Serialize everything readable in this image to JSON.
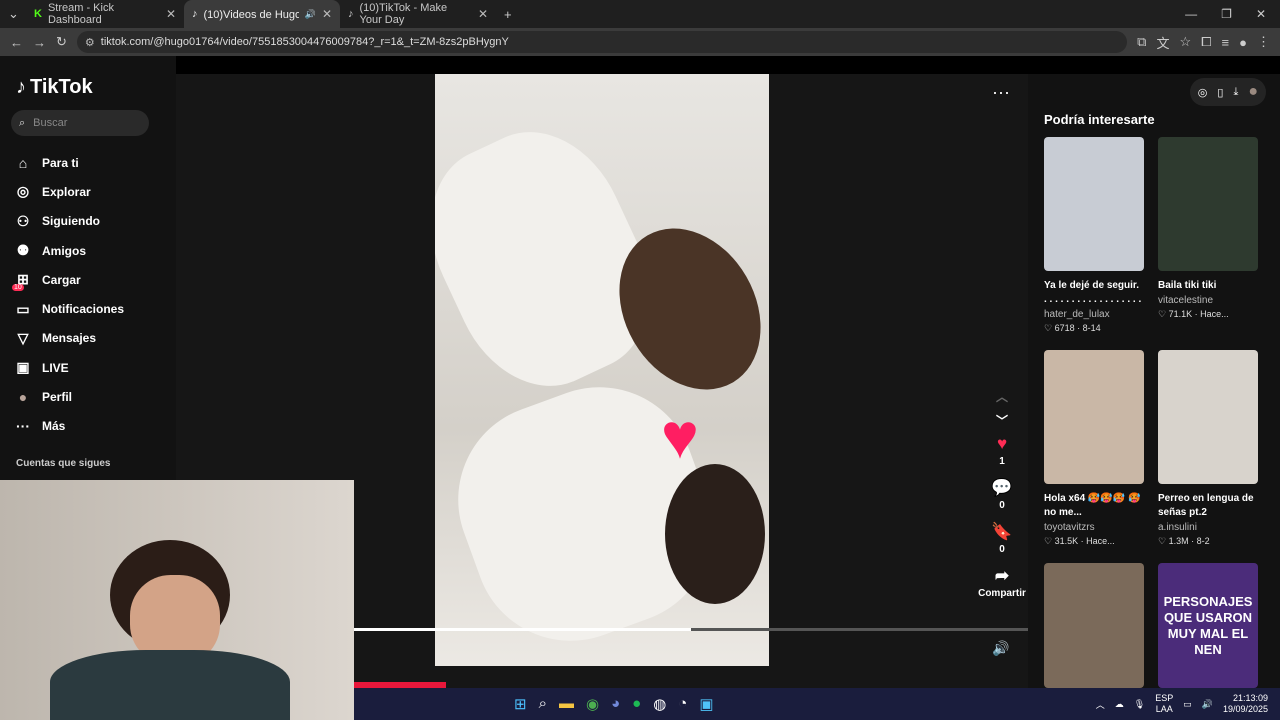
{
  "browser": {
    "tabs": [
      {
        "title": "Stream - Kick Dashboard",
        "icon": "kick-icon"
      },
      {
        "title": "(10)Videos de Hugo 💚 (@",
        "icon": "tiktok-icon"
      },
      {
        "title": "(10)TikTok - Make Your Day",
        "icon": "tiktok-icon"
      }
    ],
    "url": "tiktok.com/@hugo01764/video/7551853004476009784?_r=1&_t=ZM-8zs2pBHygnY"
  },
  "sidebar": {
    "logo": "TikTok",
    "search_placeholder": "Buscar",
    "items": [
      {
        "label": "Para ti",
        "icon": "home-icon",
        "glyph": "⌂"
      },
      {
        "label": "Explorar",
        "icon": "compass-icon",
        "glyph": "◎"
      },
      {
        "label": "Siguiendo",
        "icon": "following-icon",
        "glyph": "👤"
      },
      {
        "label": "Amigos",
        "icon": "friends-icon",
        "glyph": "👥"
      },
      {
        "label": "Cargar",
        "icon": "upload-icon",
        "glyph": "⊞"
      },
      {
        "label": "Notificaciones",
        "icon": "inbox-icon",
        "glyph": "▭"
      },
      {
        "label": "Mensajes",
        "icon": "message-icon",
        "glyph": "▽"
      },
      {
        "label": "LIVE",
        "icon": "live-icon",
        "glyph": "▣"
      },
      {
        "label": "Perfil",
        "icon": "avatar-icon",
        "glyph": "●"
      },
      {
        "label": "Más",
        "icon": "more-icon",
        "glyph": "···"
      }
    ],
    "notif_badge": "10",
    "following_heading": "Cuentas que sigues"
  },
  "video": {
    "likes": "1",
    "comments": "0",
    "saves": "0",
    "share_label": "Compartir",
    "progress": 0.5
  },
  "recommendations": {
    "title": "Podría interesarte",
    "items": [
      {
        "title": "Ya le dejé de seguir. . . . . . . . . . . . . . . . . . . .",
        "user": "hater_de_lulax",
        "likes": "6718",
        "date": "8-14",
        "color": "#c8ccd4"
      },
      {
        "title": "Baila tiki tiki",
        "user": "vitacelestine",
        "likes": "71.1K",
        "date": "Hace...",
        "color": "#2e3a2f"
      },
      {
        "title": "Hola x64 🥵🥵🥵 🥵 no me...",
        "user": "toyotavitzrs",
        "likes": "31.5K",
        "date": "Hace...",
        "color": "#c9b7a6"
      },
      {
        "title": "Perreo en lengua de señas pt.2 #insulini...",
        "user": "a.insulini",
        "likes": "1.3M",
        "date": "8-2",
        "color": "#d8d3cc"
      },
      {
        "title": "",
        "user": "",
        "likes": "",
        "date": "",
        "color": "#7b6a5a"
      },
      {
        "title": "PERSONAJES QUE USARON MUY MAL EL NEN",
        "user": "",
        "likes": "",
        "date": "",
        "color": "#4b2c7a"
      }
    ]
  },
  "taskbar": {
    "lang_top": "ESP",
    "lang_bottom": "LAA",
    "time": "21:13:09",
    "date": "19/09/2025"
  }
}
